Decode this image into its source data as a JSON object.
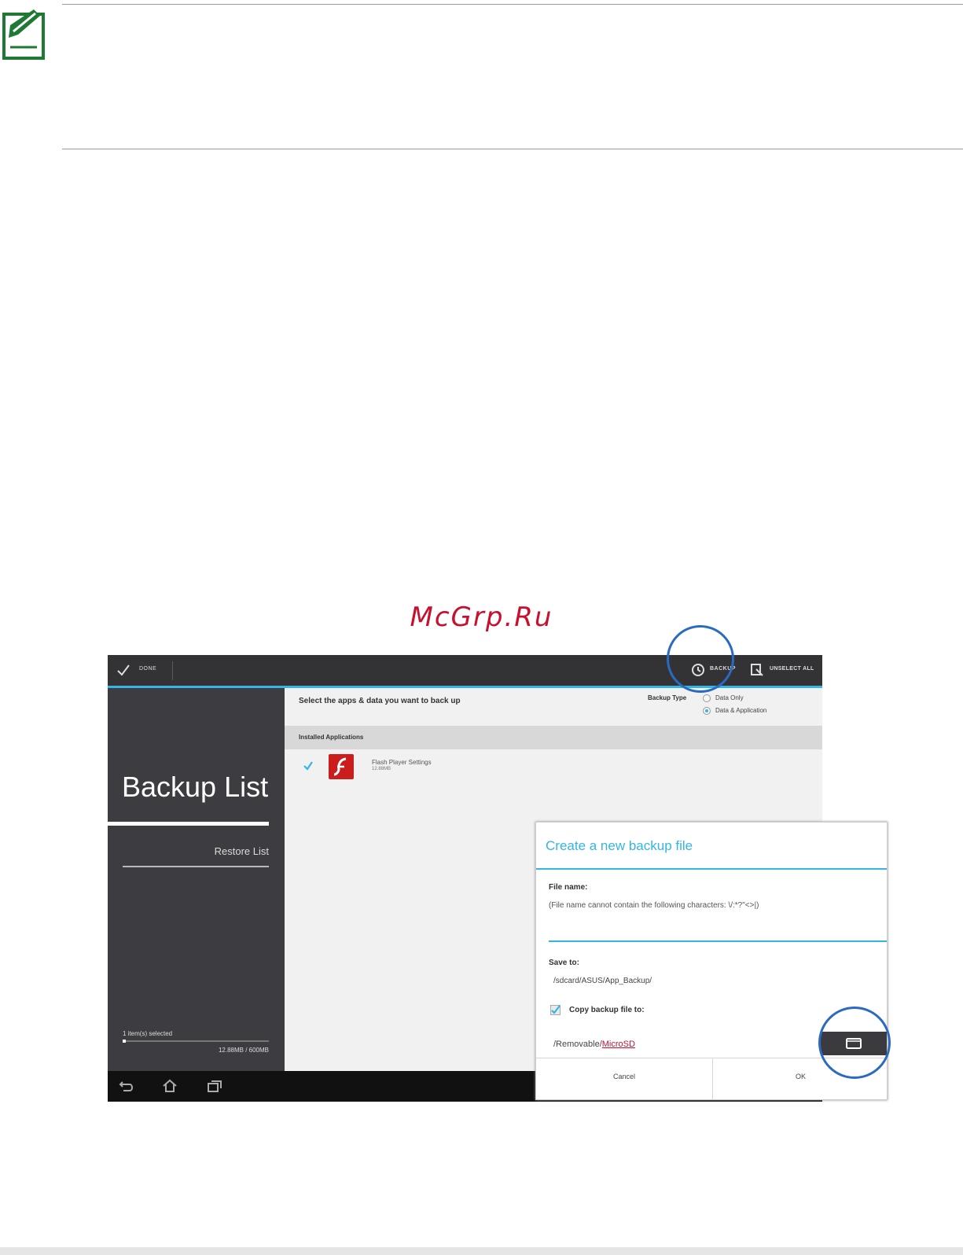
{
  "colors": {
    "note_icon": "#1e7a33",
    "accent": "#33b5e5",
    "action_bar": "#333336",
    "sidebar": "#3c3c41",
    "callout": "#2a6ac0",
    "watermark": "#c8102e"
  },
  "watermark": "McGrp.Ru",
  "action_bar": {
    "done_label": "DONE",
    "backup_label": "BACKUP",
    "unselect_all_label": "UNSELECT ALL"
  },
  "sidebar": {
    "title": "Backup List",
    "restore_label": "Restore List",
    "selected_count": "1 item(s) selected",
    "storage_text": "12.88MB / 600MB",
    "storage_fraction": 0.02
  },
  "main": {
    "heading": "Select the apps & data you want to back up",
    "backup_type_label": "Backup Type",
    "options": [
      "Data Only",
      "Data & Application"
    ],
    "selected_option": "Data & Application",
    "section_label": "Installed Applications",
    "apps": [
      {
        "name": "Flash Player Settings",
        "size": "12.88MB",
        "checked": true
      }
    ]
  },
  "dialog": {
    "title": "Create a new backup file",
    "file_name_label": "File name:",
    "file_name_hint": "(File name cannot contain the following characters: \\/:*?\"<>|)",
    "file_name_value": "",
    "save_to_label": "Save to:",
    "save_to_path": "/sdcard/ASUS/App_Backup/",
    "copy_label": "Copy backup file to:",
    "copy_checked": true,
    "destination_prefix": "/Removable/",
    "destination_link": "MicroSD",
    "cancel_label": "Cancel",
    "ok_label": "OK"
  }
}
